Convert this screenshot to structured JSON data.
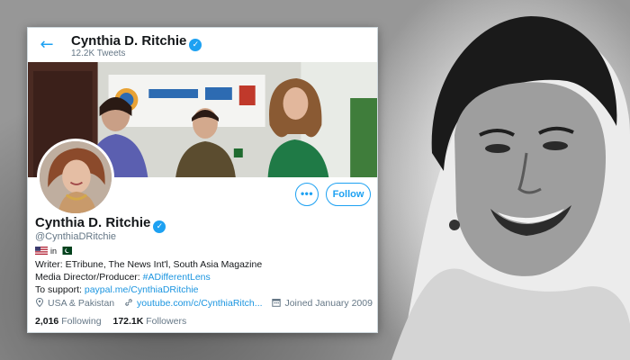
{
  "topbar": {
    "name": "Cynthia D. Ritchie",
    "tweet_count": "12.2K Tweets",
    "back_icon": "arrow-left-icon",
    "verified_icon": "verified-badge-icon"
  },
  "profile": {
    "name": "Cynthia D. Ritchie",
    "handle": "@CynthiaDRitchie",
    "flags_joiner": "in",
    "bio": {
      "line1": "Writer: ETribune, The News Int'l, South Asia Magazine",
      "line2_prefix": "Media Director/Producer: ",
      "line2_link": "#ADifferentLens",
      "line3_prefix": "To support: ",
      "line3_link": "paypal.me/CynthiaDRitchie"
    },
    "location": "USA & Pakistan",
    "website": "youtube.com/c/CynthiaRitch...",
    "joined": "Joined January 2009"
  },
  "stats": {
    "following_count": "2,016",
    "following_label": "Following",
    "followers_count": "172.1K",
    "followers_label": "Followers"
  },
  "buttons": {
    "more_label": "•••",
    "follow_label": "Follow"
  },
  "colors": {
    "accent": "#1da1f2",
    "link": "#1b95e0",
    "text": "#14171a",
    "muted": "#657786"
  }
}
